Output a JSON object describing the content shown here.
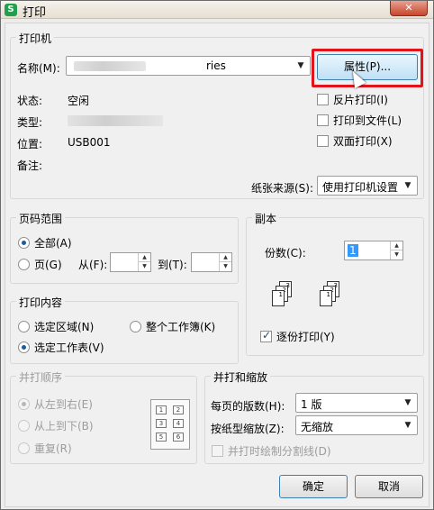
{
  "window": {
    "title": "打印",
    "app_icon_glyph": "S",
    "close_glyph": "✕"
  },
  "printer": {
    "group_title": "打印机",
    "name_label": "名称(M):",
    "name_value": "ries",
    "properties_button": "属性(P)...",
    "status_label": "状态:",
    "status_value": "空闲",
    "type_label": "类型:",
    "location_label": "位置:",
    "location_value": "USB001",
    "comment_label": "备注:",
    "reverse_print": "反片打印(I)",
    "print_to_file": "打印到文件(L)",
    "duplex_print": "双面打印(X)",
    "paper_source_label": "纸张来源(S):",
    "paper_source_value": "使用打印机设置"
  },
  "page_range": {
    "group_title": "页码范围",
    "all": "全部(A)",
    "pages": "页(G)",
    "from_label": "从(F):",
    "to_label": "到(T):"
  },
  "copies": {
    "group_title": "副本",
    "count_label": "份数(C):",
    "count_value": "1",
    "collate": "逐份打印(Y)",
    "collate_icon_pages": [
      "1",
      "2",
      "3"
    ]
  },
  "print_content": {
    "group_title": "打印内容",
    "selection": "选定区域(N)",
    "whole_workbook": "整个工作簿(K)",
    "selected_sheets": "选定工作表(V)"
  },
  "merge_order": {
    "group_title": "并打顺序",
    "left_to_right": "从左到右(E)",
    "top_to_bottom": "从上到下(B)",
    "repeat": "重复(R)",
    "diagram_cells": [
      "1",
      "2",
      "3",
      "4",
      "5",
      "6"
    ]
  },
  "merge_zoom": {
    "group_title": "并打和缩放",
    "pages_per_sheet_label": "每页的版数(H):",
    "pages_per_sheet_value": "1 版",
    "scale_to_paper_label": "按纸型缩放(Z):",
    "scale_to_paper_value": "无缩放",
    "draw_dividers": "并打时绘制分割线(D)"
  },
  "footer": {
    "ok": "确定",
    "cancel": "取消"
  },
  "colors": {
    "highlight_frame": "#e0141a",
    "selection": "#3399ff",
    "close_button": "#c8452c",
    "app_icon": "#1fa04a"
  },
  "icons": {
    "dropdown": "▼",
    "spin_up": "▲",
    "spin_down": "▼"
  }
}
